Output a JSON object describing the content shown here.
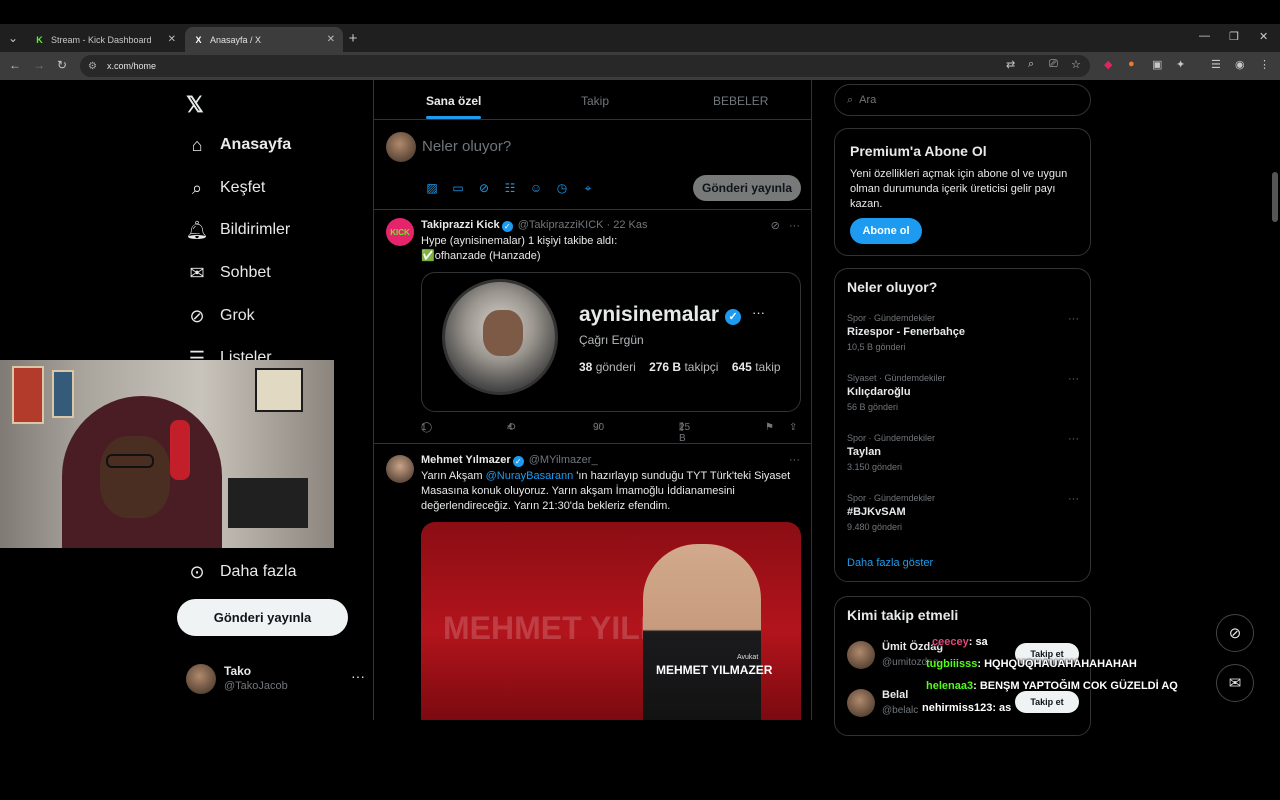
{
  "browser": {
    "tabs": [
      {
        "title": "Stream - Kick Dashboard",
        "favicon": "kick-icon",
        "active": false
      },
      {
        "title": "Anasayfa / X",
        "favicon": "x-icon",
        "active": true
      }
    ],
    "url": "x.com/home"
  },
  "nav": {
    "items": [
      {
        "label": "Anasayfa",
        "icon": "home-icon"
      },
      {
        "label": "Keşfet",
        "icon": "search-icon"
      },
      {
        "label": "Bildirimler",
        "icon": "bell-icon"
      },
      {
        "label": "Sohbet",
        "icon": "mail-icon"
      },
      {
        "label": "Grok",
        "icon": "grok-icon"
      },
      {
        "label": "Listeler",
        "icon": "list-icon"
      },
      {
        "label": "Daha fazla",
        "icon": "more-circle-icon"
      }
    ],
    "post_button": "Gönderi yayınla",
    "account": {
      "name": "Tako",
      "handle": "@TakoJacob"
    }
  },
  "feed": {
    "tabs": [
      "Sana özel",
      "Takip",
      "BEBELER"
    ],
    "selected_tab": 0,
    "compose_placeholder": "Neler oluyor?",
    "compose_button": "Gönderi yayınla",
    "tweets": [
      {
        "name": "Takiprazzi Kick",
        "handle": "@TakiprazziKICK",
        "time": "· 22 Kas",
        "avatar_text": "KICK",
        "line1": "Hype (aynisinemalar) 1 kişiyi takibe aldı:",
        "line2": "✅ofhanzade (Hanzade)",
        "card": {
          "username": "aynisinemalar",
          "fullname": "Çağrı Ergün",
          "posts": "38",
          "posts_label": "gönderi",
          "followers": "276 B",
          "followers_label": "takipçi",
          "following": "645",
          "following_label": "takip"
        },
        "replies": "1",
        "reposts": "4",
        "likes": "90",
        "views": "25 B"
      },
      {
        "name": "Mehmet Yılmazer",
        "handle": "@MYilmazer_",
        "text_before": "Yarın Akşam ",
        "mention": "@NurayBasarann",
        "text_after": " 'ın hazırlayıp sunduğu TYT Türk'teki Siyaset Masasına konuk oluyoruz. Yarın akşam İmamoğlu İddianamesini değerlendireceğiz. Yarın 21:30'da bekleriz efendim.",
        "media": {
          "big_text": "MEHMET YILMAZER",
          "role": "Avukat",
          "banner": "MEHMET YILMAZER",
          "small_role": "Avukat"
        }
      }
    ]
  },
  "sidebar": {
    "search_placeholder": "Ara",
    "premium": {
      "title": "Premium'a Abone Ol",
      "description": "Yeni özellikleri açmak için abone ol ve uygun olman durumunda içerik üreticisi gelir payı kazan.",
      "button": "Abone ol"
    },
    "trends_title": "Neler oluyor?",
    "trends": [
      {
        "category": "Spor · Gündemdekiler",
        "name": "Rizespor - Fenerbahçe",
        "posts": "10,5 B gönderi"
      },
      {
        "category": "Siyaset · Gündemdekiler",
        "name": "Kılıçdaroğlu",
        "posts": "56 B gönderi"
      },
      {
        "category": "Spor · Gündemdekiler",
        "name": "Taylan",
        "posts": "3.150 gönderi"
      },
      {
        "category": "Spor · Gündemdekiler",
        "name": "#BJKvSAM",
        "posts": "9.480 gönderi"
      }
    ],
    "show_more": "Daha fazla göster",
    "who_title": "Kimi takip etmeli",
    "who": [
      {
        "name": "Ümit Özdağ",
        "handle": "@umitozdag",
        "button": "Takip et"
      },
      {
        "name": "Belal",
        "handle": "@belalc",
        "button": "Takip et"
      }
    ]
  },
  "chat": [
    {
      "user": "ceecey",
      "text": ": sa",
      "color": "#e0457b"
    },
    {
      "user": "tugbiiisss",
      "text": ": HQHQUQHAUAHAHAHAHAH",
      "color": "#53fc18"
    },
    {
      "user": "helenaa3",
      "text": ": BENŞM YAPTOĞIM COK GÜZELDİ AQ",
      "color": "#53fc18"
    },
    {
      "user": "nehirmiss123",
      "text": ": as",
      "color": "#ffffff"
    }
  ],
  "colors": {
    "accent": "#1d9bf0",
    "background": "#000000",
    "kick_green": "#53fc18"
  }
}
